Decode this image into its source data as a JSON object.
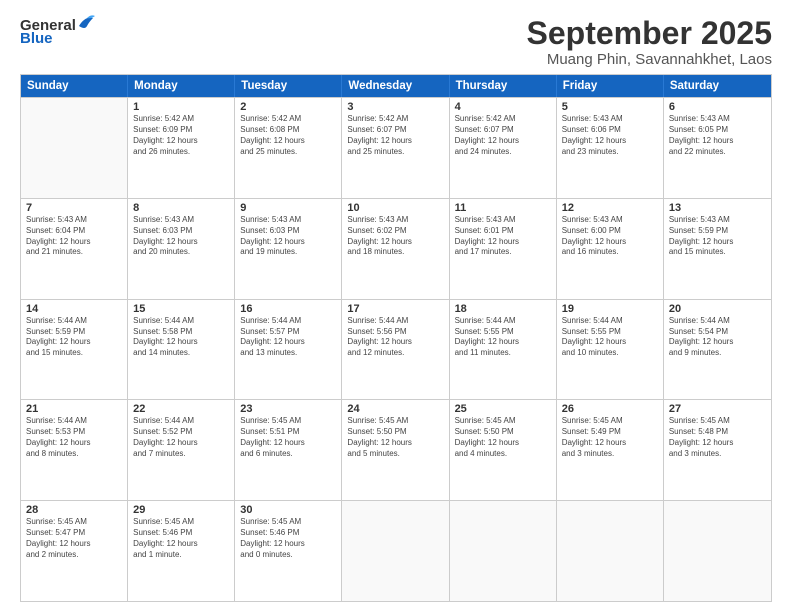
{
  "logo": {
    "general": "General",
    "blue": "Blue"
  },
  "title": "September 2025",
  "location": "Muang Phin, Savannahkhet, Laos",
  "days": [
    "Sunday",
    "Monday",
    "Tuesday",
    "Wednesday",
    "Thursday",
    "Friday",
    "Saturday"
  ],
  "weeks": [
    [
      {
        "day": "",
        "info": ""
      },
      {
        "day": "1",
        "info": "Sunrise: 5:42 AM\nSunset: 6:09 PM\nDaylight: 12 hours\nand 26 minutes."
      },
      {
        "day": "2",
        "info": "Sunrise: 5:42 AM\nSunset: 6:08 PM\nDaylight: 12 hours\nand 25 minutes."
      },
      {
        "day": "3",
        "info": "Sunrise: 5:42 AM\nSunset: 6:07 PM\nDaylight: 12 hours\nand 25 minutes."
      },
      {
        "day": "4",
        "info": "Sunrise: 5:42 AM\nSunset: 6:07 PM\nDaylight: 12 hours\nand 24 minutes."
      },
      {
        "day": "5",
        "info": "Sunrise: 5:43 AM\nSunset: 6:06 PM\nDaylight: 12 hours\nand 23 minutes."
      },
      {
        "day": "6",
        "info": "Sunrise: 5:43 AM\nSunset: 6:05 PM\nDaylight: 12 hours\nand 22 minutes."
      }
    ],
    [
      {
        "day": "7",
        "info": "Sunrise: 5:43 AM\nSunset: 6:04 PM\nDaylight: 12 hours\nand 21 minutes."
      },
      {
        "day": "8",
        "info": "Sunrise: 5:43 AM\nSunset: 6:03 PM\nDaylight: 12 hours\nand 20 minutes."
      },
      {
        "day": "9",
        "info": "Sunrise: 5:43 AM\nSunset: 6:03 PM\nDaylight: 12 hours\nand 19 minutes."
      },
      {
        "day": "10",
        "info": "Sunrise: 5:43 AM\nSunset: 6:02 PM\nDaylight: 12 hours\nand 18 minutes."
      },
      {
        "day": "11",
        "info": "Sunrise: 5:43 AM\nSunset: 6:01 PM\nDaylight: 12 hours\nand 17 minutes."
      },
      {
        "day": "12",
        "info": "Sunrise: 5:43 AM\nSunset: 6:00 PM\nDaylight: 12 hours\nand 16 minutes."
      },
      {
        "day": "13",
        "info": "Sunrise: 5:43 AM\nSunset: 5:59 PM\nDaylight: 12 hours\nand 15 minutes."
      }
    ],
    [
      {
        "day": "14",
        "info": "Sunrise: 5:44 AM\nSunset: 5:59 PM\nDaylight: 12 hours\nand 15 minutes."
      },
      {
        "day": "15",
        "info": "Sunrise: 5:44 AM\nSunset: 5:58 PM\nDaylight: 12 hours\nand 14 minutes."
      },
      {
        "day": "16",
        "info": "Sunrise: 5:44 AM\nSunset: 5:57 PM\nDaylight: 12 hours\nand 13 minutes."
      },
      {
        "day": "17",
        "info": "Sunrise: 5:44 AM\nSunset: 5:56 PM\nDaylight: 12 hours\nand 12 minutes."
      },
      {
        "day": "18",
        "info": "Sunrise: 5:44 AM\nSunset: 5:55 PM\nDaylight: 12 hours\nand 11 minutes."
      },
      {
        "day": "19",
        "info": "Sunrise: 5:44 AM\nSunset: 5:55 PM\nDaylight: 12 hours\nand 10 minutes."
      },
      {
        "day": "20",
        "info": "Sunrise: 5:44 AM\nSunset: 5:54 PM\nDaylight: 12 hours\nand 9 minutes."
      }
    ],
    [
      {
        "day": "21",
        "info": "Sunrise: 5:44 AM\nSunset: 5:53 PM\nDaylight: 12 hours\nand 8 minutes."
      },
      {
        "day": "22",
        "info": "Sunrise: 5:44 AM\nSunset: 5:52 PM\nDaylight: 12 hours\nand 7 minutes."
      },
      {
        "day": "23",
        "info": "Sunrise: 5:45 AM\nSunset: 5:51 PM\nDaylight: 12 hours\nand 6 minutes."
      },
      {
        "day": "24",
        "info": "Sunrise: 5:45 AM\nSunset: 5:50 PM\nDaylight: 12 hours\nand 5 minutes."
      },
      {
        "day": "25",
        "info": "Sunrise: 5:45 AM\nSunset: 5:50 PM\nDaylight: 12 hours\nand 4 minutes."
      },
      {
        "day": "26",
        "info": "Sunrise: 5:45 AM\nSunset: 5:49 PM\nDaylight: 12 hours\nand 3 minutes."
      },
      {
        "day": "27",
        "info": "Sunrise: 5:45 AM\nSunset: 5:48 PM\nDaylight: 12 hours\nand 3 minutes."
      }
    ],
    [
      {
        "day": "28",
        "info": "Sunrise: 5:45 AM\nSunset: 5:47 PM\nDaylight: 12 hours\nand 2 minutes."
      },
      {
        "day": "29",
        "info": "Sunrise: 5:45 AM\nSunset: 5:46 PM\nDaylight: 12 hours\nand 1 minute."
      },
      {
        "day": "30",
        "info": "Sunrise: 5:45 AM\nSunset: 5:46 PM\nDaylight: 12 hours\nand 0 minutes."
      },
      {
        "day": "",
        "info": ""
      },
      {
        "day": "",
        "info": ""
      },
      {
        "day": "",
        "info": ""
      },
      {
        "day": "",
        "info": ""
      }
    ]
  ]
}
